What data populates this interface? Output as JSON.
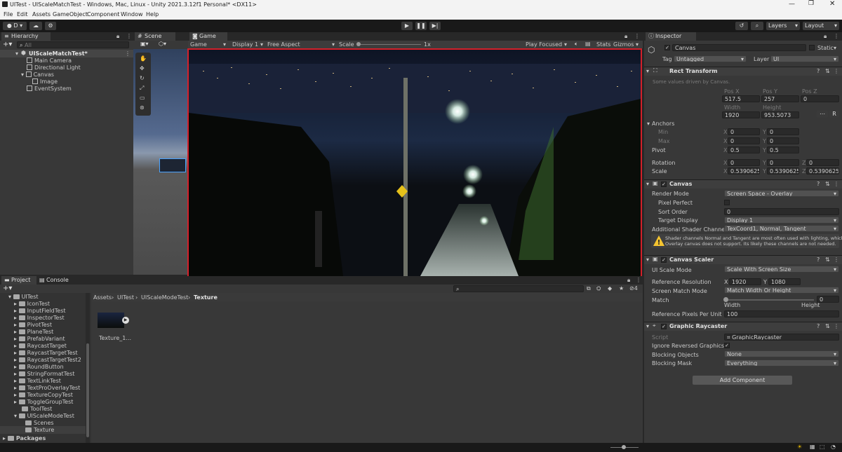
{
  "window": {
    "title": "UITest - UIScaleMatchTest - Windows, Mac, Linux - Unity 2021.3.12f1 Personal* <DX11>"
  },
  "menu": [
    "File",
    "Edit",
    "Assets",
    "GameObject",
    "Component",
    "Window",
    "Help"
  ],
  "toolbar": {
    "account": "D",
    "layers": "Layers",
    "layout": "Layout"
  },
  "hierarchy": {
    "tab": "Hierarchy",
    "search_placeholder": "All",
    "items": [
      {
        "label": "UIScaleMatchTest*"
      },
      {
        "label": "Main Camera"
      },
      {
        "label": "Directional Light"
      },
      {
        "label": "Canvas"
      },
      {
        "label": "Image"
      },
      {
        "label": "EventSystem"
      }
    ]
  },
  "scene": {
    "tab": "Scene"
  },
  "game": {
    "tab": "Game",
    "mode": "Game",
    "display": "Display 1",
    "aspect": "Free Aspect",
    "scale_label": "Scale",
    "scale_value": "1x",
    "play_focused": "Play Focused",
    "stats": "Stats",
    "gizmos": "Gizmos"
  },
  "project": {
    "tabs": [
      "Project",
      "Console"
    ],
    "tree": [
      "UITest",
      "IconTest",
      "InputFieldTest",
      "InspectorTest",
      "PivotTest",
      "PlaneTest",
      "PrefabVariant",
      "RaycastTarget",
      "RaycastTargetTest",
      "RaycastTargetTest2",
      "RoundButton",
      "StringFormatTest",
      "TextLinkTest",
      "TextProOverlayTest",
      "TextureCopyTest",
      "ToggleGroupTest",
      "ToolTest",
      "UIScaleModeTest",
      "Scenes",
      "Texture",
      "Packages"
    ],
    "breadcrumb": [
      "Assets",
      "UITest",
      "UIScaleModeTest",
      "Texture"
    ],
    "asset_label": "Texture_1...",
    "hidden_count": "4"
  },
  "inspector": {
    "tab": "Inspector",
    "object_name": "Canvas",
    "static_label": "Static",
    "tag_label": "Tag",
    "tag_value": "Untagged",
    "layer_label": "Layer",
    "layer_value": "UI",
    "rect": {
      "title": "Rect Transform",
      "note": "Some values driven by Canvas.",
      "pos_x_label": "Pos X",
      "pos_y_label": "Pos Y",
      "pos_z_label": "Pos Z",
      "pos_x": "517.5",
      "pos_y": "257",
      "pos_z": "0",
      "width_label": "Width",
      "height_label": "Height",
      "width": "1920",
      "height": "953.5073",
      "anchors": "Anchors",
      "min": "Min",
      "max": "Max",
      "min_x": "0",
      "min_y": "0",
      "max_x": "0",
      "max_y": "0",
      "pivot": "Pivot",
      "pivot_x": "0.5",
      "pivot_y": "0.5",
      "rotation": "Rotation",
      "rot_x": "0",
      "rot_y": "0",
      "rot_z": "0",
      "scale": "Scale",
      "scale_x": "0.5390625",
      "scale_y": "0.5390625",
      "scale_z": "0.5390625",
      "x": "X",
      "y": "Y",
      "z": "Z",
      "r": "R"
    },
    "canvas": {
      "title": "Canvas",
      "render_mode_label": "Render Mode",
      "render_mode": "Screen Space - Overlay",
      "pixel_perfect": "Pixel Perfect",
      "sort_order_label": "Sort Order",
      "sort_order": "0",
      "target_display_label": "Target Display",
      "target_display": "Display 1",
      "shader_channels_label": "Additional Shader Channels",
      "shader_channels": "TexCoord1, Normal, Tangent",
      "warning_line1": "Shader channels Normal and Tangent are most often used with lighting, which an",
      "warning_line2": "Overlay canvas does not support. Its likely these channels are not needed."
    },
    "scaler": {
      "title": "Canvas Scaler",
      "ui_scale_mode_label": "UI Scale Mode",
      "ui_scale_mode": "Scale With Screen Size",
      "ref_res_label": "Reference Resolution",
      "ref_x": "1920",
      "ref_y": "1080",
      "match_mode_label": "Screen Match Mode",
      "match_mode": "Match Width Or Height",
      "match_label": "Match",
      "match_value": "0",
      "match_fraction": 0,
      "width_label": "Width",
      "height_label": "Height",
      "ref_ppu_label": "Reference Pixels Per Unit",
      "ref_ppu": "100"
    },
    "raycaster": {
      "title": "Graphic Raycaster",
      "script_label": "Script",
      "script": "GraphicRaycaster",
      "ignore_reversed_label": "Ignore Reversed Graphics",
      "blocking_objects_label": "Blocking Objects",
      "blocking_objects": "None",
      "blocking_mask_label": "Blocking Mask",
      "blocking_mask": "Everything"
    },
    "add_component": "Add Component"
  },
  "colors": {
    "accent": "#2c5d87",
    "game_border": "#d3202a",
    "selection": "#2c5d87"
  }
}
